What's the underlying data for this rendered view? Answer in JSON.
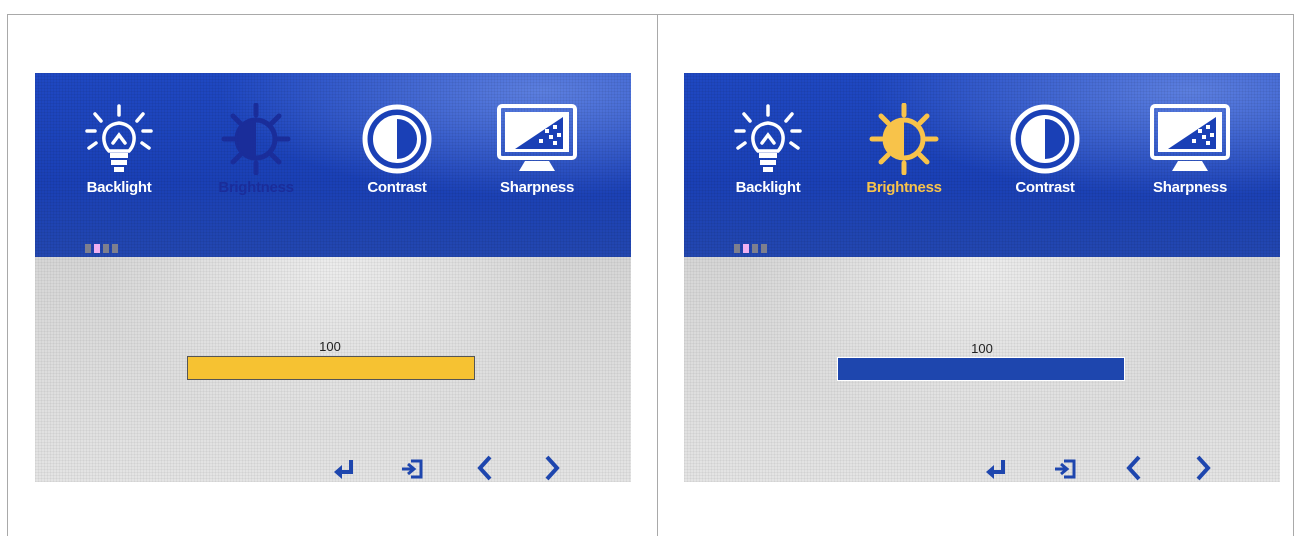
{
  "panels": [
    {
      "menu": [
        "Backlight",
        "Brightness",
        "Contrast",
        "Sharpness"
      ],
      "selected": "Brightness",
      "selected_color": "#1a2d9a",
      "page_indicator": {
        "count": 4,
        "active_index": 1
      },
      "value": "100",
      "level": 1.0,
      "bar_color": "#f6c232"
    },
    {
      "menu": [
        "Backlight",
        "Brightness",
        "Contrast",
        "Sharpness"
      ],
      "selected": "Brightness",
      "selected_color": "#f8c34a",
      "page_indicator": {
        "count": 4,
        "active_index": 1
      },
      "value": "100",
      "level": 1.0,
      "bar_color": "#1e46ae"
    }
  ],
  "icons": [
    "lightbulb-icon",
    "sun-icon",
    "contrast-icon",
    "sharpness-monitor-icon"
  ],
  "nav_icons": [
    "enter-icon",
    "exit-icon",
    "left-arrow-icon",
    "right-arrow-icon"
  ],
  "colors": {
    "osd_blue": "#1a40b6",
    "osd_gray": "#e0e0e0",
    "nav_blue": "#1e46ae"
  }
}
